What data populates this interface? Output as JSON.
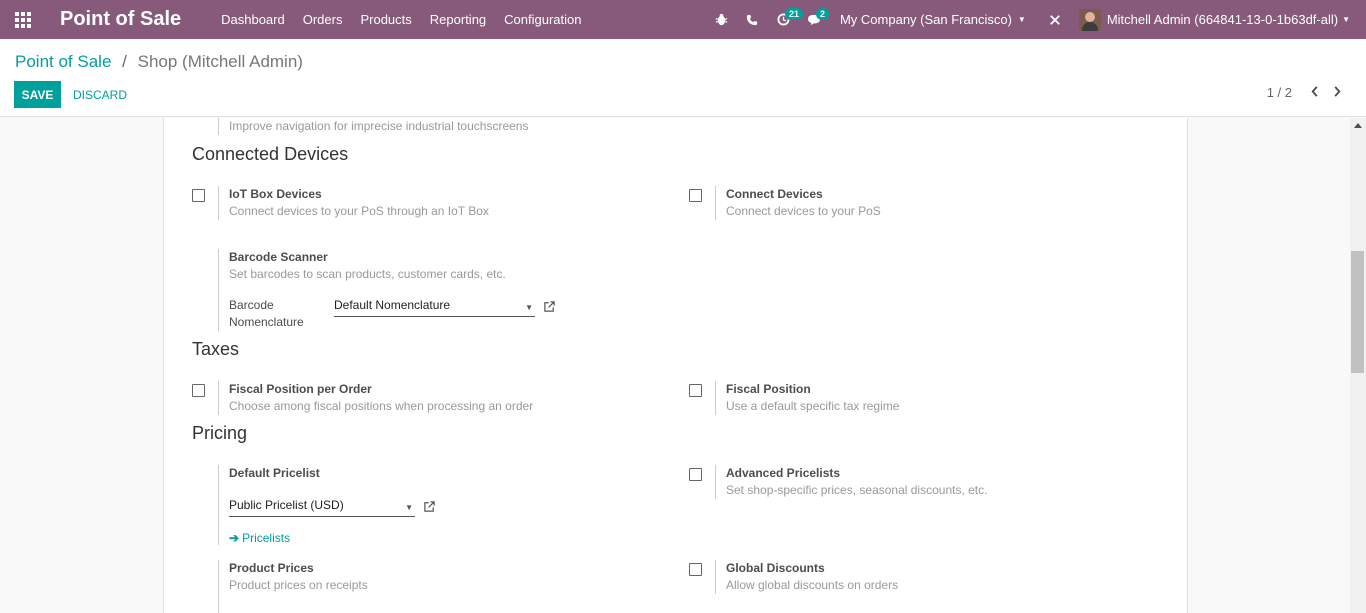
{
  "navbar": {
    "app_title": "Point of Sale",
    "menu": [
      "Dashboard",
      "Orders",
      "Products",
      "Reporting",
      "Configuration"
    ],
    "activity_count": "21",
    "message_count": "2",
    "company": "My Company (San Francisco)",
    "user": "Mitchell Admin (664841-13-0-1b63df-all)"
  },
  "breadcrumb": {
    "parent": "Point of Sale",
    "separator": "/",
    "current": "Shop (Mitchell Admin)"
  },
  "buttons": {
    "save": "SAVE",
    "discard": "DISCARD"
  },
  "pager": {
    "value": "1 / 2"
  },
  "settings": {
    "touchscreen_desc": "Improve navigation for imprecise industrial touchscreens",
    "connected_devices": {
      "title": "Connected Devices",
      "iot_box": {
        "label": "IoT Box Devices",
        "desc": "Connect devices to your PoS through an IoT Box"
      },
      "connect_devices": {
        "label": "Connect Devices",
        "desc": "Connect devices to your PoS"
      },
      "barcode_scanner": {
        "label": "Barcode Scanner",
        "desc": "Set barcodes to scan products, customer cards, etc.",
        "nomenclature_label": "Barcode Nomenclature",
        "nomenclature_value": "Default Nomenclature"
      }
    },
    "taxes": {
      "title": "Taxes",
      "fiscal_position_per_order": {
        "label": "Fiscal Position per Order",
        "desc": "Choose among fiscal positions when processing an order"
      },
      "fiscal_position": {
        "label": "Fiscal Position",
        "desc": "Use a default specific tax regime"
      }
    },
    "pricing": {
      "title": "Pricing",
      "default_pricelist": {
        "label": "Default Pricelist",
        "value": "Public Pricelist (USD)",
        "link": "Pricelists"
      },
      "advanced_pricelists": {
        "label": "Advanced Pricelists",
        "desc": "Set shop-specific prices, seasonal discounts, etc."
      },
      "product_prices": {
        "label": "Product Prices",
        "desc": "Product prices on receipts"
      },
      "global_discounts": {
        "label": "Global Discounts",
        "desc": "Allow global discounts on orders"
      }
    }
  }
}
